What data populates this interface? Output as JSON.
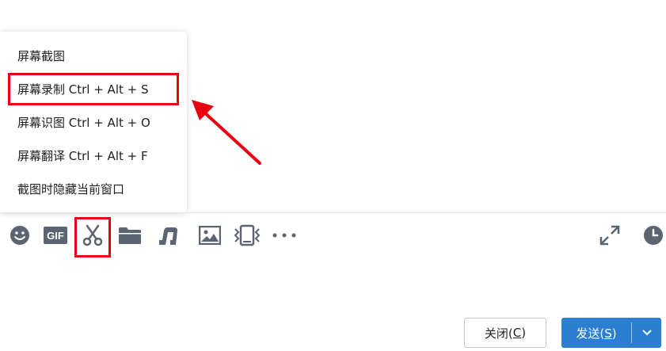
{
  "menu": {
    "items": [
      {
        "label": "屏幕截图"
      },
      {
        "label": "屏幕录制 Ctrl + Alt + S"
      },
      {
        "label": "屏幕识图 Ctrl + Alt + O"
      },
      {
        "label": "屏幕翻译 Ctrl + Alt + F"
      },
      {
        "label": "截图时隐藏当前窗口"
      }
    ]
  },
  "toolbar": {
    "icons": [
      "emoji-icon",
      "gif-icon",
      "scissors-icon",
      "folder-icon",
      "music-icon",
      "image-icon",
      "shake-icon",
      "more-icon",
      "expand-icon",
      "history-clock-icon"
    ],
    "gif_label": "GIF"
  },
  "buttons": {
    "close_label_pre": "关闭(",
    "close_label_key": "C",
    "close_label_post": ")",
    "send_label_pre": "发送(",
    "send_label_key": "S",
    "send_label_post": ")"
  },
  "colors": {
    "highlight": "#e60012",
    "send_button": "#2b7ed0",
    "icon": "#5b6470"
  }
}
